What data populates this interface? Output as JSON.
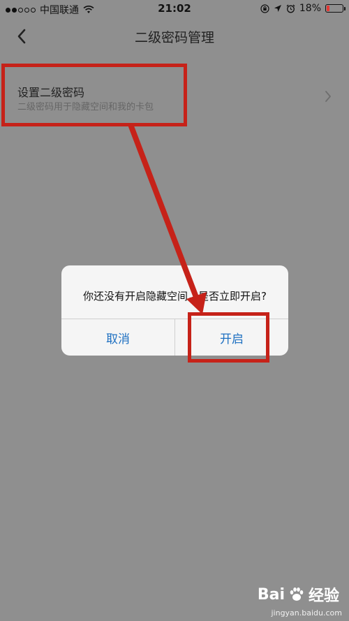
{
  "status_bar": {
    "carrier": "中国联通",
    "time": "21:02",
    "battery_percent": "18%",
    "battery_level": 0.18,
    "battery_color": "#e53935"
  },
  "nav": {
    "title": "二级密码管理",
    "back_icon": "chevron-left-icon"
  },
  "settings_row": {
    "title": "设置二级密码",
    "subtitle": "二级密码用于隐藏空间和我的卡包",
    "chevron_icon": "chevron-right-icon"
  },
  "dialog": {
    "message": "你还没有开启隐藏空间，是否立即开启?",
    "cancel_label": "取消",
    "confirm_label": "开启"
  },
  "annotation_color": "#c62219",
  "watermark": {
    "brand": "Bai",
    "suffix": "经验",
    "site": "jingyan.baidu.com"
  }
}
